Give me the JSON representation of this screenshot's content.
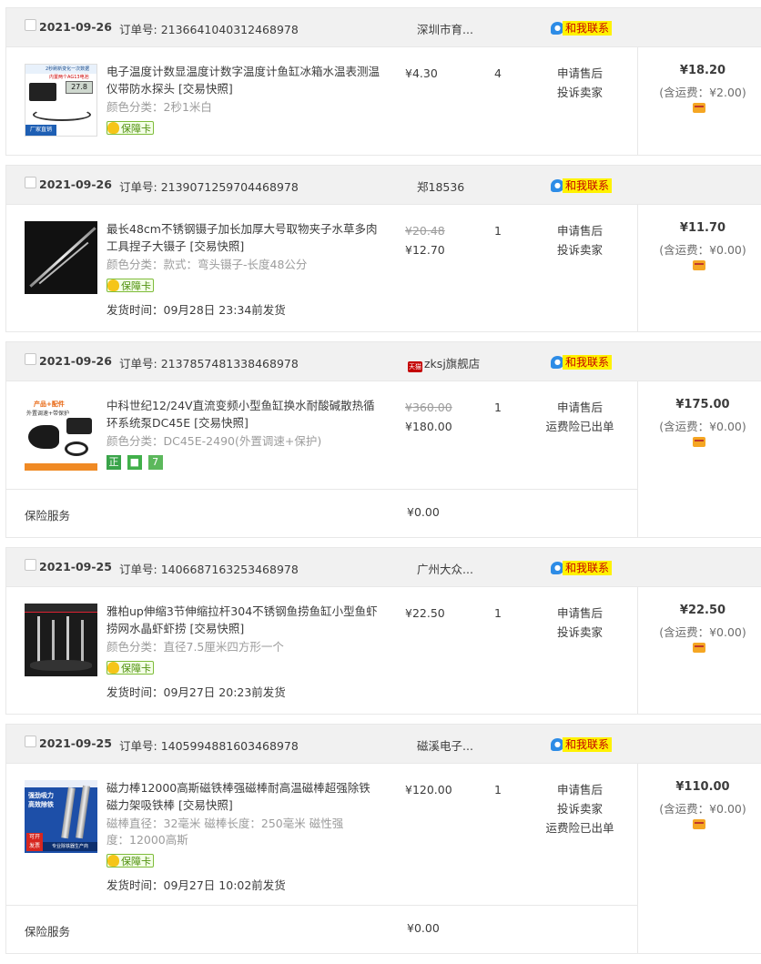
{
  "labels": {
    "order_no": "订单号:",
    "contact": "和我联系",
    "tmall": "天猫",
    "guarantee": "保障卡",
    "insurance": "保险服务"
  },
  "orders": [
    {
      "date": "2021-09-26",
      "order_no": "2136641040312468978",
      "shop": "深圳市育...",
      "total": "¥18.20",
      "shipping": "(含运费：¥2.00)",
      "item": {
        "title": "电子温度计数显温度计数字温度计鱼缸冰箱水温表测温仪带防水探头 [交易快照]",
        "sku": "颜色分类：2秒1米白",
        "price": "¥4.30",
        "qty": "4",
        "ops": [
          "申请售后",
          "投诉卖家"
        ],
        "thumb_text": [
          "2秒刷新变化一次数据",
          "内置两个AG13电池",
          "27.8",
          "厂家直销"
        ]
      }
    },
    {
      "date": "2021-09-26",
      "order_no": "2139071259704468978",
      "shop": "郑18536",
      "total": "¥11.70",
      "shipping": "(含运费：¥0.00)",
      "item": {
        "title": "最长48cm不锈钢镊子加长加厚大号取物夹子水草多肉工具捏子大镊子 [交易快照]",
        "sku": "颜色分类：款式：弯头镊子-长度48公分",
        "old_price": "¥20.48",
        "price": "¥12.70",
        "qty": "1",
        "ops": [
          "申请售后",
          "投诉卖家"
        ],
        "deliver": "发货时间：09月28日 23:34前发货"
      }
    },
    {
      "date": "2021-09-26",
      "order_no": "2137857481338468978",
      "shop": "zksj旗舰店",
      "total": "¥175.00",
      "shipping": "(含运费：¥0.00)",
      "item": {
        "title": "中科世纪12/24V直流变频小型鱼缸换水耐酸碱散热循环系统泵DC45E [交易快照]",
        "sku": "颜色分类：DC45E-2490(外置调速+保护)",
        "old_price": "¥360.00",
        "price": "¥180.00",
        "qty": "1",
        "ops": [
          "申请售后",
          "运费险已出单"
        ],
        "badges": [
          "正",
          "7"
        ],
        "thumb_text": [
          "产品+配件",
          "外置调速+带保护"
        ]
      },
      "insurance_value": "¥0.00"
    },
    {
      "date": "2021-09-25",
      "order_no": "1406687163253468978",
      "shop": "广州大众...",
      "total": "¥22.50",
      "shipping": "(含运费：¥0.00)",
      "item": {
        "title": "雅柏up伸缩3节伸缩拉杆304不锈钢鱼捞鱼缸小型鱼虾捞网水晶虾虾捞 [交易快照]",
        "sku": "颜色分类：直径7.5厘米四方形一个",
        "price": "¥22.50",
        "qty": "1",
        "ops": [
          "申请售后",
          "投诉卖家"
        ],
        "deliver": "发货时间：09月27日 20:23前发货"
      }
    },
    {
      "date": "2021-09-25",
      "order_no": "1405994881603468978",
      "shop": "磁溪电子...",
      "total": "¥110.00",
      "shipping": "(含运费：¥0.00)",
      "item": {
        "title": "磁力棒12000高斯磁铁棒强磁棒耐高温磁棒超强除铁磁力架吸铁棒 [交易快照]",
        "sku": "磁棒直径：32毫米  磁棒长度：250毫米  磁性强度：12000高斯",
        "price": "¥120.00",
        "qty": "1",
        "ops": [
          "申请售后",
          "投诉卖家",
          "运费险已出单"
        ],
        "deliver": "发货时间：09月27日 10:02前发货",
        "thumb_text": [
          "强劲吸力",
          "高效除铁",
          "可开",
          "发票",
          "专业除铁器生产商"
        ]
      },
      "insurance_value": "¥0.00"
    }
  ]
}
